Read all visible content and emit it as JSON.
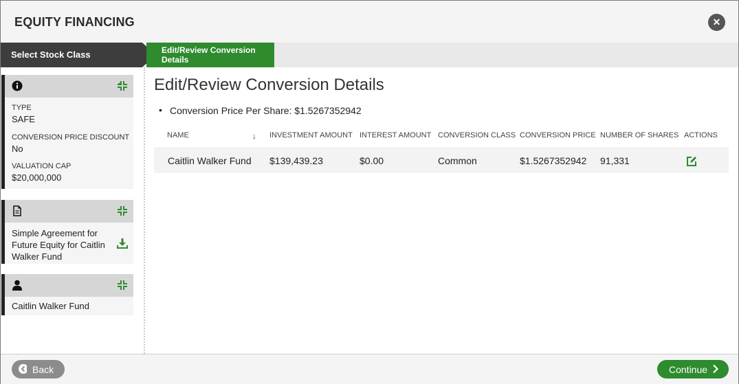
{
  "header": {
    "title": "EQUITY FINANCING",
    "close_glyph": "✕"
  },
  "steps": [
    {
      "label": "Select Stock Class"
    },
    {
      "label": "Edit/Review Conversion Details"
    }
  ],
  "sidebar": {
    "info_card": {
      "icon": "info-icon",
      "fields": [
        {
          "label": "TYPE",
          "value": "SAFE"
        },
        {
          "label": "CONVERSION PRICE DISCOUNT",
          "value": "No"
        },
        {
          "label": "VALUATION CAP",
          "value": "$20,000,000"
        }
      ]
    },
    "document_card": {
      "icon": "document-icon",
      "text": "Simple Agreement for Future Equity for Caitlin Walker Fund"
    },
    "investor_card": {
      "icon": "user-icon",
      "text": "Caitlin Walker Fund"
    }
  },
  "main": {
    "title": "Edit/Review Conversion Details",
    "conversion_price_line": "Conversion Price Per Share: $1.5267352942",
    "table": {
      "columns": [
        "NAME",
        "INVESTMENT AMOUNT",
        "INTEREST AMOUNT",
        "CONVERSION CLASS",
        "CONVERSION PRICE",
        "NUMBER OF SHARES",
        "ACTIONS"
      ],
      "sort_indicator": "↓",
      "rows": [
        [
          "Caitlin Walker Fund",
          "$139,439.23",
          "$0.00",
          "Common",
          "$1.5267352942",
          "91,331"
        ]
      ]
    }
  },
  "footer": {
    "back_label": "Back",
    "continue_label": "Continue"
  },
  "colors": {
    "accent": "#2e8b2e",
    "dark": "#3a3a3a",
    "muted": "#8c8c8c"
  }
}
